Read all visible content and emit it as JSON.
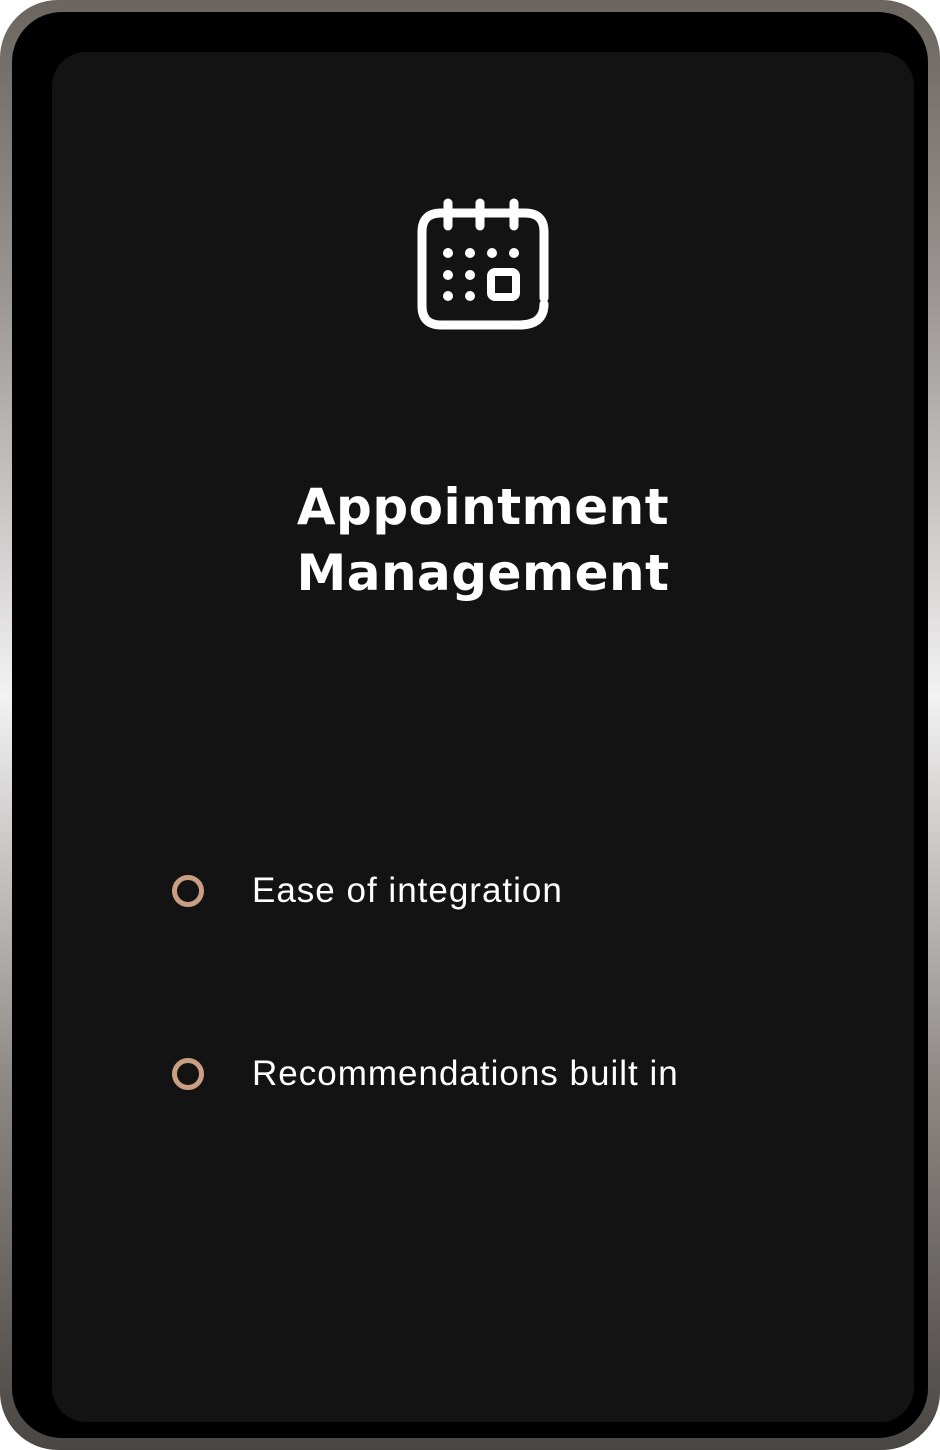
{
  "card": {
    "icon": "calendar-icon",
    "title_line1": "Appointment",
    "title_line2": "Management",
    "features": [
      {
        "label": "Ease of integration",
        "icon": "ring-bullet-icon"
      },
      {
        "label": "Recommendations built in",
        "icon": "ring-bullet-icon"
      }
    ]
  },
  "colors": {
    "screen_background": "#141314",
    "text": "#ffffff",
    "bullet_accent": "#c99f84"
  }
}
